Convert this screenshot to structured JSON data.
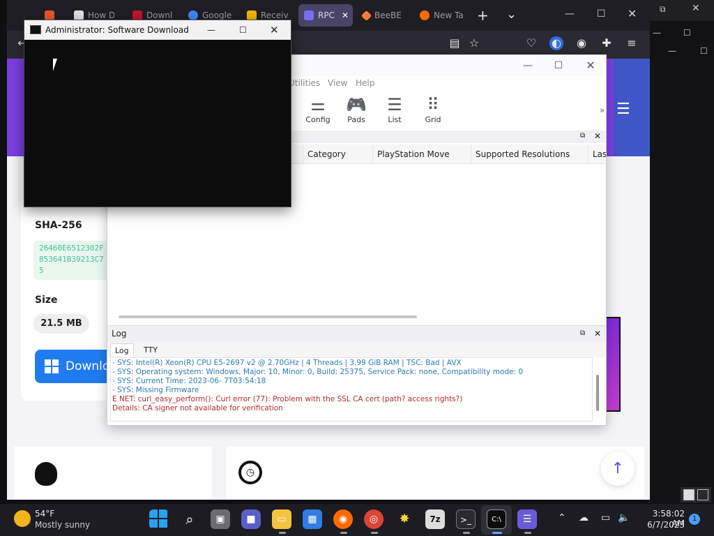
{
  "browser": {
    "tabs": [
      {
        "label": "",
        "color": "#e4572e"
      },
      {
        "label": "How D",
        "color": "#e0e0e0"
      },
      {
        "label": "Downl",
        "color": "#c0152f"
      },
      {
        "label": "Google",
        "color": "#4285f4"
      },
      {
        "label": "Receiv",
        "color": "#f3b600"
      },
      {
        "label": "RPC",
        "color": "#7c6cf2"
      },
      {
        "label": "BeeBE",
        "color": "#ff7a30"
      },
      {
        "label": "New Ta",
        "color": "#ff6a00"
      }
    ],
    "new_tab_glyph": "+",
    "tab_list_glyph": "⌄"
  },
  "page": {
    "sha_label": "SHA-256",
    "sha_value": "26460E6512302F853641B39213C75",
    "size_label": "Size",
    "size_value": "21.5 MB",
    "download_label": "Downlo"
  },
  "terminal": {
    "title": "Administrator:  Software Download"
  },
  "rpcs3": {
    "menu": [
      "Utilities",
      "View",
      "Help"
    ],
    "tools": [
      {
        "label": "Config",
        "icon": "toggle-switches-icon"
      },
      {
        "label": "Pads",
        "icon": "gamepad-icon"
      },
      {
        "label": "List",
        "icon": "list-icon"
      },
      {
        "label": "Grid",
        "icon": "grid-icon"
      }
    ],
    "more_glyph": "»",
    "columns": [
      "Category",
      "PlayStation Move",
      "Supported Resolutions",
      "Last"
    ],
    "log_title": "Log",
    "log_tabs": [
      "Log",
      "TTY"
    ],
    "log_lines": [
      {
        "text": "- SYS: Intel(R) Xeon(R) CPU E5-2697 v2 @ 2.70GHz | 4 Threads | 3.99 GiB RAM | TSC: Bad | AVX",
        "level": "ok"
      },
      {
        "text": "- SYS: Operating system: Windows, Major: 10, Minor: 0, Build: 25375, Service Pack: none, Compatibility mode: 0",
        "level": "ok"
      },
      {
        "text": "- SYS: Current Time: 2023-06- 7T03:54:18",
        "level": "ok"
      },
      {
        "text": "- SYS: Missing Firmware",
        "level": "ok"
      },
      {
        "text": "E NET: curl_easy_perform(): Curl error (77): Problem with the SSL CA cert (path? access rights?)",
        "level": "err"
      },
      {
        "text": "Details: CA signer not available for verification",
        "level": "err"
      }
    ]
  },
  "taskbar": {
    "weather_temp": "54°F",
    "weather_desc": "Mostly sunny",
    "clock_time": "3:58:02 AM",
    "clock_date": "6/7/2023",
    "notification_count": "1"
  }
}
